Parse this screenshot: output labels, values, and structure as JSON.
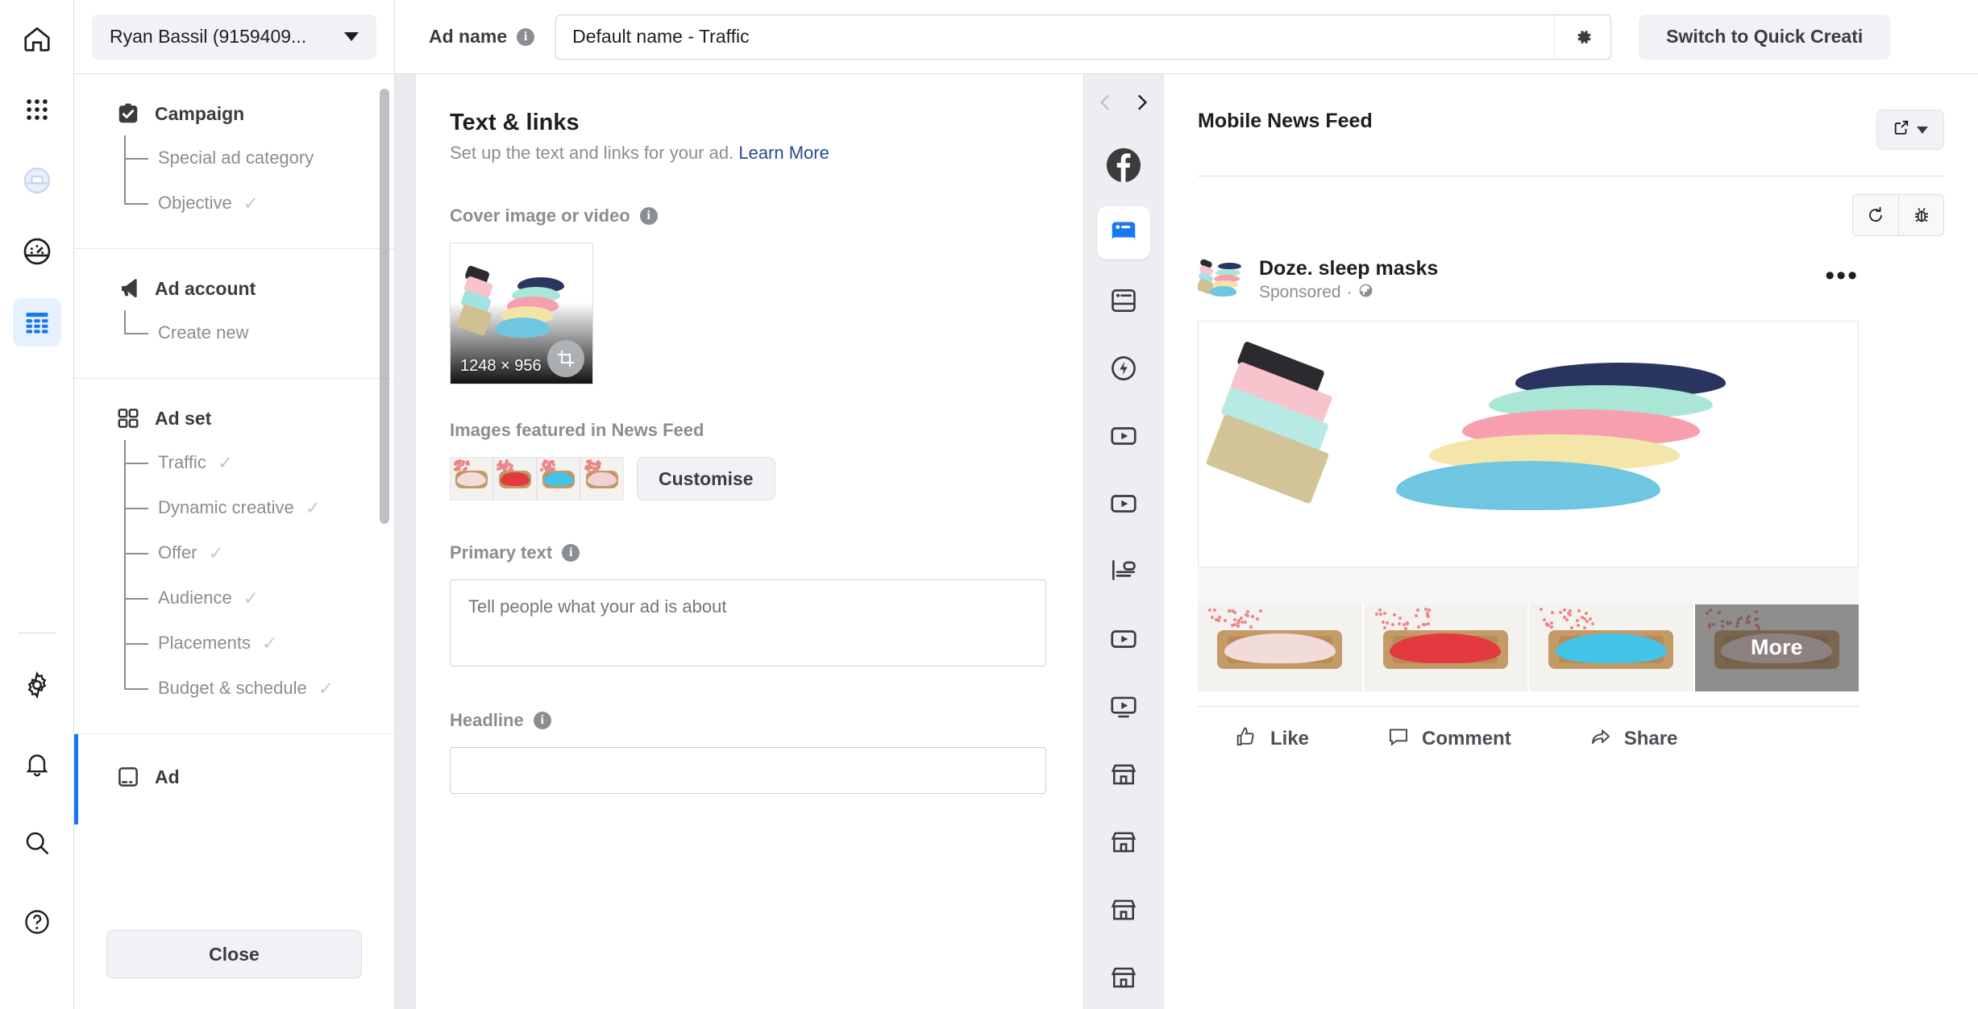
{
  "nav_rail": {
    "items": [
      {
        "name": "home-icon",
        "label": "Home"
      },
      {
        "name": "grid-apps-icon",
        "label": "All tools"
      },
      {
        "name": "business-suite-icon",
        "label": "Business suite"
      },
      {
        "name": "gauge-icon",
        "label": "Performance"
      },
      {
        "name": "table-icon",
        "label": "Ads manager",
        "selected": true
      }
    ],
    "bottom_items": [
      {
        "name": "gear-icon",
        "label": "Settings"
      },
      {
        "name": "bell-icon",
        "label": "Notifications"
      },
      {
        "name": "search-icon",
        "label": "Search"
      },
      {
        "name": "help-icon",
        "label": "Help"
      }
    ]
  },
  "sidebar": {
    "account_selector": {
      "value": "Ryan Bassil (9159409...",
      "caret": "chevron-down-icon"
    },
    "groups": [
      {
        "icon": "campaign-checkbox-icon",
        "title": "Campaign",
        "items": [
          {
            "label": "Special ad category",
            "done": false
          },
          {
            "label": "Objective",
            "done": true
          }
        ]
      },
      {
        "icon": "megaphone-icon",
        "title": "Ad account",
        "items": [
          {
            "label": "Create new",
            "done": false
          }
        ]
      },
      {
        "icon": "adset-grid-icon",
        "title": "Ad set",
        "items": [
          {
            "label": "Traffic",
            "done": true
          },
          {
            "label": "Dynamic creative",
            "done": true
          },
          {
            "label": "Offer",
            "done": true
          },
          {
            "label": "Audience",
            "done": true
          },
          {
            "label": "Placements",
            "done": true
          },
          {
            "label": "Budget & schedule",
            "done": true
          }
        ]
      },
      {
        "icon": "ad-tablet-icon",
        "title": "Ad",
        "items": []
      }
    ],
    "close_label": "Close"
  },
  "topbar": {
    "ad_name_label": "Ad name",
    "ad_name_info": "info-icon",
    "ad_name_value": "Default name - Traffic",
    "ad_name_placeholder": "Default name - Traffic",
    "gear_icon": "gear-icon",
    "quick_creation_label": "Switch to Quick Creati"
  },
  "form": {
    "section_title": "Text & links",
    "section_sub": "Set up the text and links for your ad.",
    "learn_more": "Learn More",
    "cover_label": "Cover image or video",
    "cover_dimensions": "1248 × 956",
    "cover_crop_icon": "crop-icon",
    "featured_label": "Images featured in News Feed",
    "customise_label": "Customise",
    "featured_thumbs": [
      {
        "name": "thumb-mask-cream",
        "color": "#f2dcd9"
      },
      {
        "name": "thumb-mask-red",
        "color": "#e23a3f"
      },
      {
        "name": "thumb-mask-blue",
        "color": "#44c3e8"
      },
      {
        "name": "thumb-mask-pink",
        "color": "#efd3d4"
      }
    ],
    "primary_text_label": "Primary text",
    "primary_text_value": "",
    "primary_text_placeholder": "Tell people what your ad is about",
    "headline_label": "Headline",
    "headline_value": "",
    "headline_placeholder": ""
  },
  "rail": {
    "prev_icon": "chevron-left-icon",
    "next_icon": "chevron-right-icon",
    "platform_icon": "facebook-icon",
    "placements": [
      {
        "name": "mobile-news-feed-icon",
        "selected": true
      },
      {
        "name": "desktop-news-feed-icon",
        "selected": false
      },
      {
        "name": "instant-article-icon",
        "selected": false
      },
      {
        "name": "in-stream-video-icon",
        "selected": false
      },
      {
        "name": "video-feeds-icon",
        "selected": false
      },
      {
        "name": "right-column-icon",
        "selected": false
      },
      {
        "name": "video-feed-icon-2",
        "selected": false
      },
      {
        "name": "search-results-video-icon",
        "selected": false
      },
      {
        "name": "marketplace-icon-1",
        "selected": false
      },
      {
        "name": "marketplace-icon-2",
        "selected": false
      },
      {
        "name": "marketplace-icon-3",
        "selected": false
      },
      {
        "name": "marketplace-icon-4",
        "selected": false
      }
    ]
  },
  "preview": {
    "title": "Mobile News Feed",
    "popout_icon": "external-link-icon",
    "popout_caret": "chevron-down-icon",
    "refresh_icon": "refresh-icon",
    "bug_icon": "bug-icon",
    "ad": {
      "avatar": "page-avatar",
      "page_name": "Doze. sleep masks",
      "sponsored_label": "Sponsored",
      "sponsored_separator": "·",
      "globe_icon": "globe-icon",
      "more_options_icon": "ellipsis-icon",
      "hero_image": "sleep-masks-hero",
      "carousel": [
        {
          "name": "carousel-card-cream",
          "color": "#f2dcd9",
          "overlay": null
        },
        {
          "name": "carousel-card-red",
          "color": "#e23a3f",
          "overlay": null
        },
        {
          "name": "carousel-card-blue",
          "color": "#44c3e8",
          "overlay": null
        },
        {
          "name": "carousel-card-more",
          "color": "#d7b5b5",
          "overlay": "More"
        }
      ],
      "actions": [
        {
          "name": "like-action",
          "icon": "thumbs-up-icon",
          "label": "Like"
        },
        {
          "name": "comment-action",
          "icon": "comment-bubble-icon",
          "label": "Comment"
        },
        {
          "name": "share-action",
          "icon": "share-arrow-icon",
          "label": "Share"
        }
      ]
    }
  },
  "colors": {
    "accent_blue": "#1877f2",
    "link_blue": "#2b4a8b",
    "muted": "#8a8d91",
    "panel_bg": "#eceef1"
  }
}
